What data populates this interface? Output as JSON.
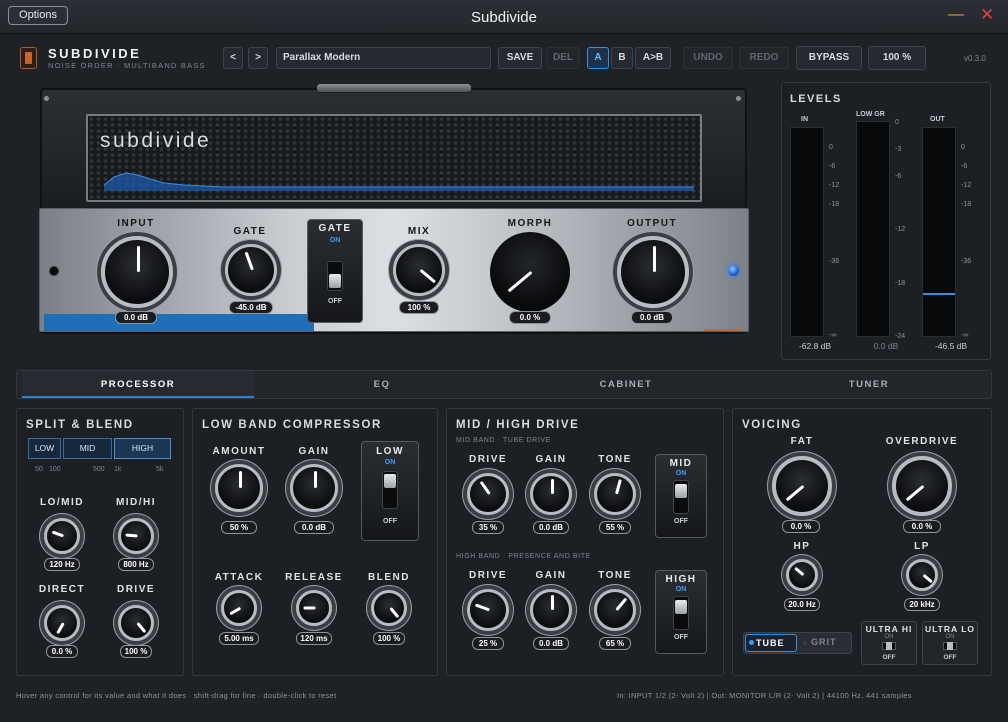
{
  "window": {
    "title": "Subdivide",
    "options_label": "Options",
    "min_glyph": "—",
    "close_glyph": "✕"
  },
  "brand": {
    "name": "SUBDIVIDE",
    "subtitle": "NOISE ORDER · MULTIBAND BASS",
    "version": "v0.3.0"
  },
  "toolbar": {
    "prev": "<",
    "next": ">",
    "preset": "Parallax Modern",
    "save": "SAVE",
    "del": "DEL",
    "a": "A",
    "b": "B",
    "ab": "A>B",
    "undo": "UNDO",
    "redo": "REDO",
    "bypass": "BYPASS",
    "zoom": "100 %"
  },
  "amp": {
    "name": "subdivide",
    "knobs": [
      {
        "label": "INPUT",
        "value": "0.0 dB"
      },
      {
        "label": "GATE",
        "value": "-45.0 dB"
      },
      {
        "label": "MIX",
        "value": "100 %"
      },
      {
        "label": "MORPH",
        "value": "0.0 %"
      },
      {
        "label": "OUTPUT",
        "value": "0.0 dB"
      }
    ],
    "gate_switch": {
      "title": "GATE",
      "on": "ON",
      "off": "OFF"
    }
  },
  "levels": {
    "title": "LEVELS",
    "in": {
      "label": "IN",
      "value": "-62.8 dB",
      "ticks": [
        "0",
        "-6",
        "-12",
        "-18",
        "-36",
        "-∞"
      ]
    },
    "gr": {
      "label": "LOW GR",
      "value": "0.0 dB",
      "ticks": [
        "0",
        "-3",
        "-6",
        "-12",
        "-18",
        "-24"
      ]
    },
    "out": {
      "label": "OUT",
      "value": "-46.5 dB",
      "ticks": [
        "0",
        "-6",
        "-12",
        "-18",
        "-36",
        "-∞"
      ]
    }
  },
  "tabs": [
    "PROCESSOR",
    "EQ",
    "CABINET",
    "TUNER"
  ],
  "split": {
    "title": "SPLIT & BLEND",
    "bands": [
      "LOW",
      "MID",
      "HIGH"
    ],
    "ticks": [
      "50",
      "100",
      "500",
      "1k",
      "5k"
    ],
    "knobs": [
      {
        "label": "LO/MID",
        "value": "120 Hz"
      },
      {
        "label": "MID/HI",
        "value": "800 Hz"
      },
      {
        "label": "DIRECT",
        "value": "0.0 %"
      },
      {
        "label": "DRIVE",
        "value": "100 %"
      }
    ]
  },
  "comp": {
    "title": "LOW BAND COMPRESSOR",
    "knobs": [
      {
        "label": "AMOUNT",
        "value": "50 %"
      },
      {
        "label": "GAIN",
        "value": "0.0 dB"
      },
      {
        "label": "ATTACK",
        "value": "5.00 ms"
      },
      {
        "label": "RELEASE",
        "value": "120 ms"
      },
      {
        "label": "BLEND",
        "value": "100 %"
      }
    ],
    "switch": {
      "title": "LOW",
      "on": "ON",
      "off": "OFF"
    }
  },
  "drive": {
    "title": "MID / HIGH DRIVE",
    "mid_sub": "MID BAND · TUBE DRIVE",
    "high_sub": "HIGH BAND · PRESENCE AND BITE",
    "mid_knobs": [
      {
        "label": "DRIVE",
        "value": "35 %"
      },
      {
        "label": "GAIN",
        "value": "0.0 dB"
      },
      {
        "label": "TONE",
        "value": "55 %"
      }
    ],
    "high_knobs": [
      {
        "label": "DRIVE",
        "value": "25 %"
      },
      {
        "label": "GAIN",
        "value": "0.0 dB"
      },
      {
        "label": "TONE",
        "value": "65 %"
      }
    ],
    "mid_switch": {
      "title": "MID",
      "on": "ON",
      "off": "OFF"
    },
    "high_switch": {
      "title": "HIGH",
      "on": "ON",
      "off": "OFF"
    }
  },
  "voicing": {
    "title": "VOICING",
    "knobs": [
      {
        "label": "FAT",
        "value": "0.0 %"
      },
      {
        "label": "OVERDRIVE",
        "value": "0.0 %"
      },
      {
        "label": "HP",
        "value": "20.0 Hz"
      },
      {
        "label": "LP",
        "value": "20 kHz"
      }
    ],
    "tube": "TUBE",
    "grit": "GRIT",
    "ultra_hi": {
      "title": "ULTRA HI",
      "on": "ON",
      "off": "OFF"
    },
    "ultra_lo": {
      "title": "ULTRA LO",
      "on": "ON",
      "off": "OFF"
    }
  },
  "footer": {
    "hint": "Hover any control for its value and what it does · shift-drag for fine · double-click to reset",
    "status": "In: INPUT 1/2 (2- Volt 2)  |  Out: MONITOR L/R (2- Volt 2)  |  44100 Hz, 441 samples"
  },
  "colors": {
    "accent": "#2f7fd0",
    "bg": "#1e2126",
    "brand": "#c8642e"
  }
}
